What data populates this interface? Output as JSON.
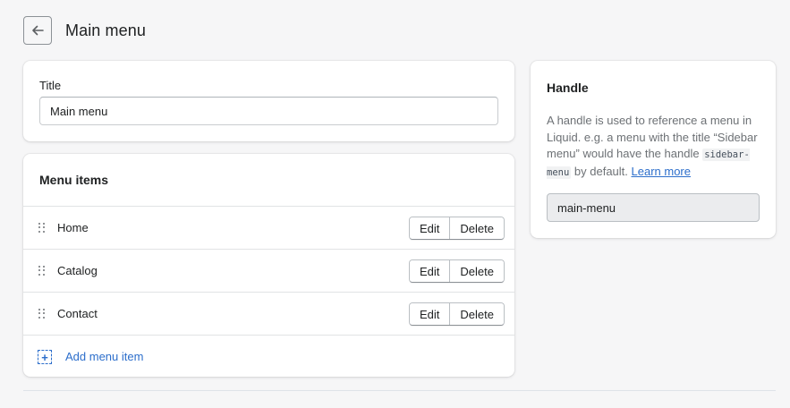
{
  "header": {
    "title": "Main menu",
    "back_icon": "arrow-left-icon"
  },
  "title_card": {
    "label": "Title",
    "value": "Main menu"
  },
  "menu_items": {
    "heading": "Menu items",
    "items": [
      {
        "label": "Home",
        "edit": "Edit",
        "delete": "Delete"
      },
      {
        "label": "Catalog",
        "edit": "Edit",
        "delete": "Delete"
      },
      {
        "label": "Contact",
        "edit": "Edit",
        "delete": "Delete"
      }
    ],
    "add_label": "Add menu item",
    "add_icon": "add-dashed-icon"
  },
  "handle": {
    "title": "Handle",
    "help_prefix": "A handle is used to reference a menu in Liquid. e.g. a menu with the title “Sidebar menu” would have the handle ",
    "help_code": "sidebar-menu",
    "help_suffix": " by default. ",
    "learn_more": "Learn more",
    "value": "main-menu"
  },
  "colors": {
    "link": "#2c6ecb",
    "background": "#f6f6f7",
    "card": "#ffffff"
  }
}
